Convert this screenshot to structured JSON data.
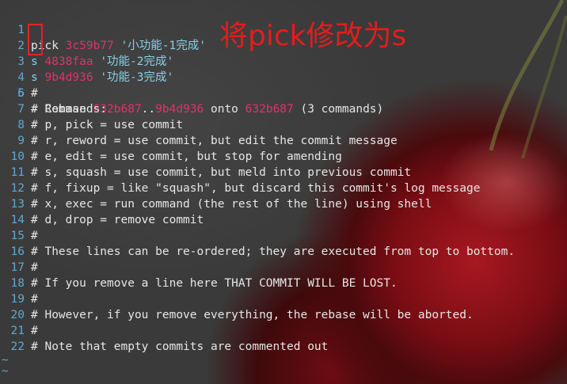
{
  "annotation": {
    "text": "将pick修改为s",
    "color": "#e51c1c"
  },
  "colors": {
    "line_number": "#5fa8d3",
    "hash": "#e0326a",
    "string": "#8ad0e6",
    "text": "#e6e6e6",
    "background": "#3a3a3a"
  },
  "editor": {
    "lines": [
      {
        "num": "1",
        "cmd": "pick",
        "hash": "3c59b77",
        "msg": "'小功能-1完成'"
      },
      {
        "num": "2",
        "cmd": "s",
        "hash": "4838faa",
        "msg": "'功能-2完成'"
      },
      {
        "num": "3",
        "cmd": "s",
        "hash": "9b4d936",
        "msg": "'功能-3完成'"
      },
      {
        "num": "4",
        "text": ""
      },
      {
        "num": "5",
        "pre": "# Rebase ",
        "h1": "632b687",
        "mid": "..",
        "h2": "9b4d936",
        "mid2": " onto ",
        "h3": "632b687",
        "post": " (3 commands)"
      },
      {
        "num": "6",
        "text": "#"
      },
      {
        "num": "7",
        "text": "# Commands:"
      },
      {
        "num": "8",
        "text": "# p, pick = use commit"
      },
      {
        "num": "9",
        "text": "# r, reword = use commit, but edit the commit message"
      },
      {
        "num": "10",
        "text": "# e, edit = use commit, but stop for amending"
      },
      {
        "num": "11",
        "text": "# s, squash = use commit, but meld into previous commit"
      },
      {
        "num": "12",
        "text": "# f, fixup = like \"squash\", but discard this commit's log message"
      },
      {
        "num": "13",
        "text": "# x, exec = run command (the rest of the line) using shell"
      },
      {
        "num": "14",
        "text": "# d, drop = remove commit"
      },
      {
        "num": "15",
        "text": "#"
      },
      {
        "num": "16",
        "text": "# These lines can be re-ordered; they are executed from top to bottom."
      },
      {
        "num": "17",
        "text": "#"
      },
      {
        "num": "18",
        "text": "# If you remove a line here THAT COMMIT WILL BE LOST."
      },
      {
        "num": "19",
        "text": "#"
      },
      {
        "num": "20",
        "text": "# However, if you remove everything, the rebase will be aborted."
      },
      {
        "num": "21",
        "text": "#"
      },
      {
        "num": "22",
        "text": "# Note that empty commits are commented out"
      }
    ],
    "tilde": "~"
  }
}
